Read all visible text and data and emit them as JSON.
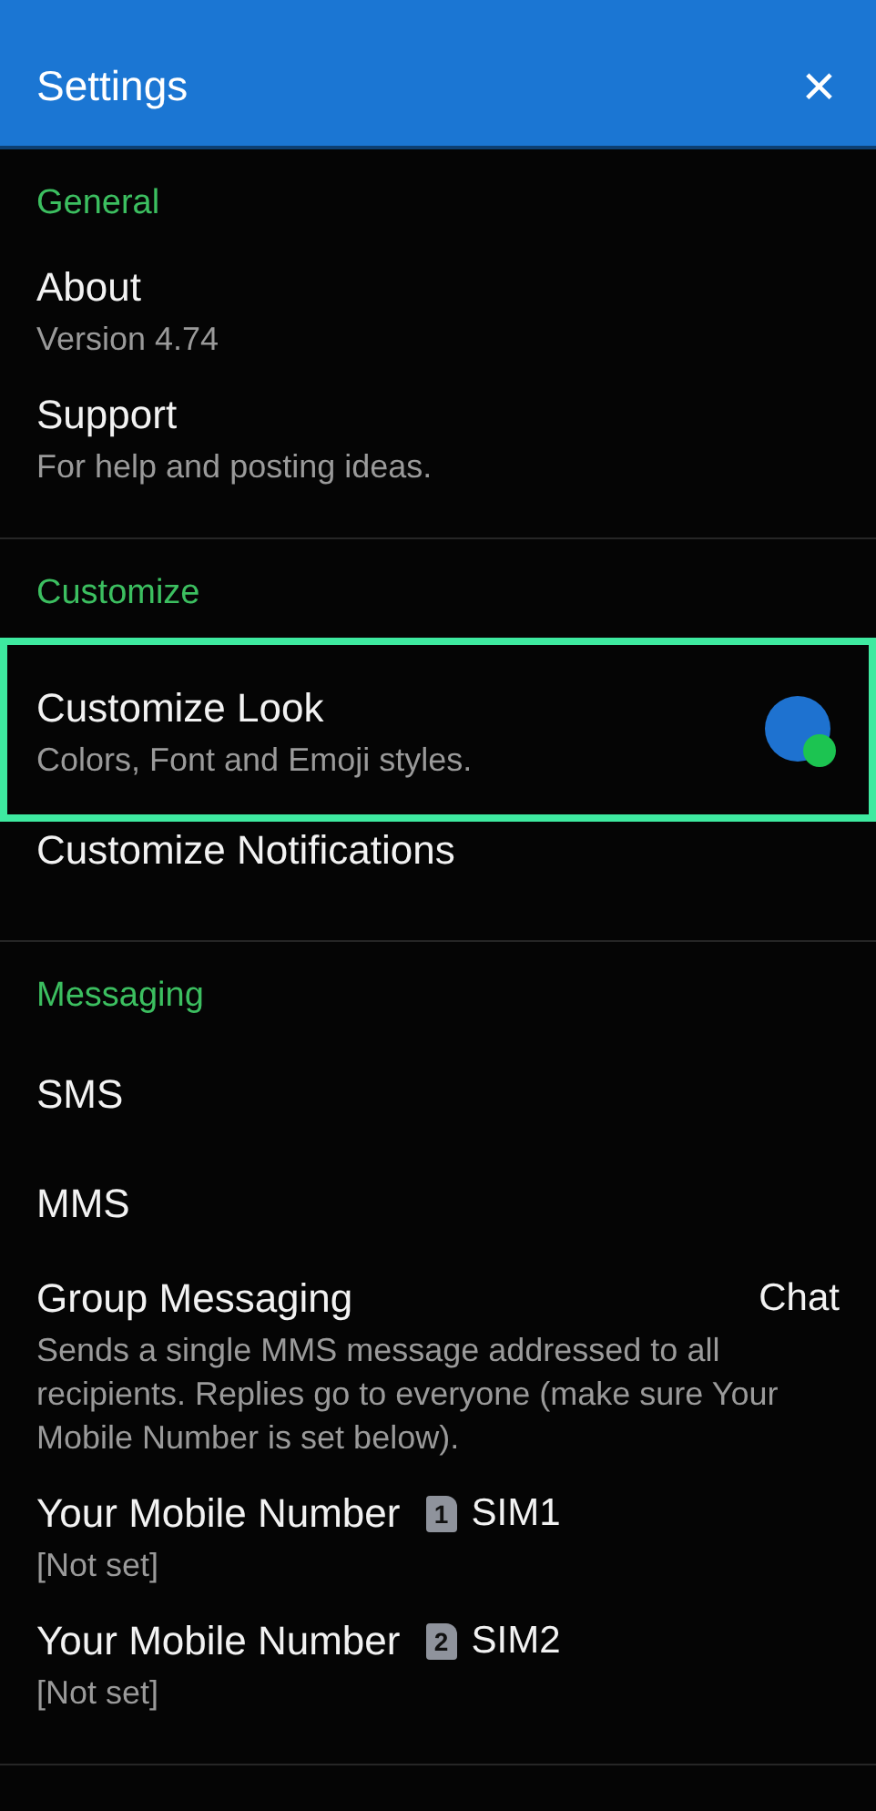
{
  "app_bar": {
    "title": "Settings",
    "close_icon": "×"
  },
  "sections": [
    {
      "title": "General",
      "items": [
        {
          "kind": "plain",
          "title": "About",
          "subtitle": "Version 4.74",
          "highlighted": false
        },
        {
          "kind": "plain",
          "title": "Support",
          "subtitle": "For help and posting ideas.",
          "highlighted": false
        }
      ]
    },
    {
      "title": "Customize",
      "items": [
        {
          "kind": "theme",
          "title": "Customize Look",
          "subtitle": "Colors, Font and Emoji styles.",
          "highlighted": true
        },
        {
          "kind": "plain",
          "title": "Customize Notifications",
          "highlighted": false
        }
      ]
    },
    {
      "title": "Messaging",
      "items": [
        {
          "kind": "plain",
          "title": "SMS",
          "highlighted": false
        },
        {
          "kind": "plain",
          "title": "MMS",
          "highlighted": false
        },
        {
          "kind": "value",
          "title": "Group Messaging",
          "value": "Chat",
          "subtitle": "Sends a single MMS message addressed to all recipients. Replies go to everyone (make sure Your Mobile Number is set below).",
          "highlighted": false
        },
        {
          "kind": "sim",
          "title": "Your Mobile Number",
          "sim_number": "1",
          "value": "SIM1",
          "subtitle": "[Not set]",
          "highlighted": false
        },
        {
          "kind": "sim",
          "title": "Your Mobile Number",
          "sim_number": "2",
          "value": "SIM2",
          "subtitle": "[Not set]",
          "highlighted": false
        }
      ]
    }
  ]
}
